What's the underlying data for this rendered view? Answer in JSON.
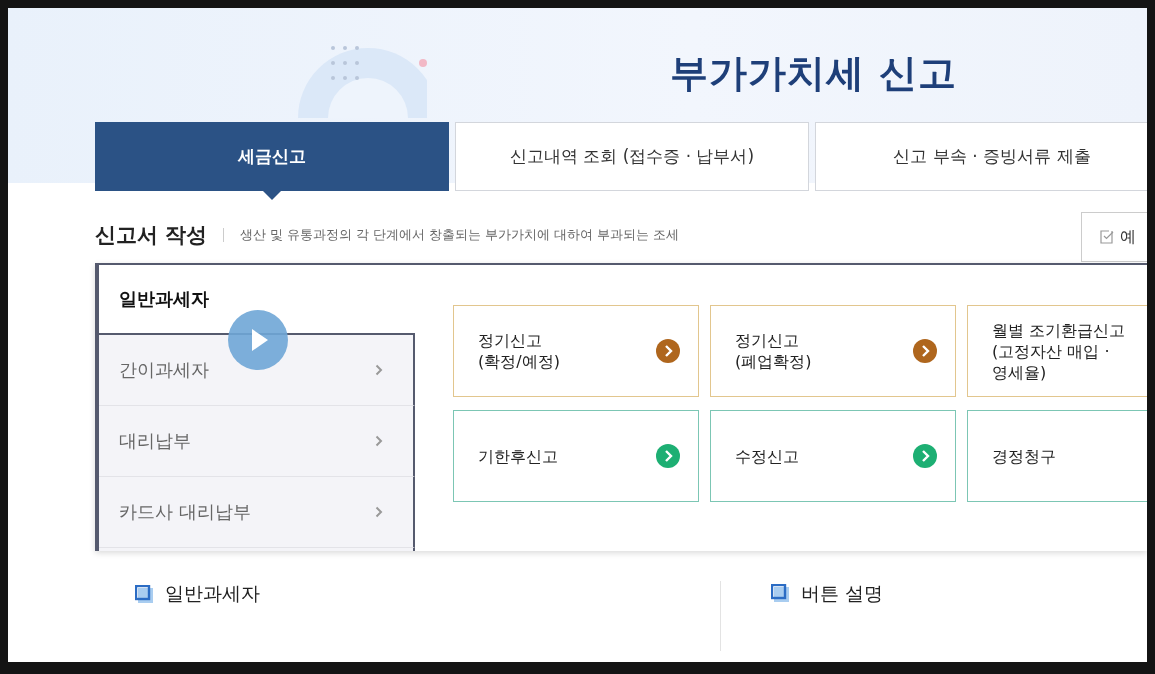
{
  "header": {
    "title": "부가가치세 신고"
  },
  "tabs": [
    {
      "label": "세금신고",
      "selected": true
    },
    {
      "label": "신고내역 조회 (접수증 · 납부서)",
      "selected": false
    },
    {
      "label": "신고 부속 · 증빙서류 제출",
      "selected": false
    }
  ],
  "section": {
    "title": "신고서 작성",
    "description": "생산 및 유통과정의 각 단계에서 창출되는 부가가치에 대하여 부과되는 조세",
    "button": "예"
  },
  "menu": [
    {
      "label": "일반과세자",
      "selected": true
    },
    {
      "label": "간이과세자",
      "selected": false
    },
    {
      "label": "대리납부",
      "selected": false
    },
    {
      "label": "카드사 대리납부",
      "selected": false
    }
  ],
  "cards": [
    {
      "lines": [
        "정기신고",
        "(확정/예정)"
      ],
      "color": "#e2c68e",
      "arrow": true
    },
    {
      "lines": [
        "정기신고",
        "(폐업확정)"
      ],
      "color": "#e2c68e",
      "arrow": true
    },
    {
      "lines": [
        "월별 조기환급신고",
        "(고정자산 매입 ·",
        "영세율)"
      ],
      "color": "#e2c68e",
      "arrow": false
    },
    {
      "lines": [
        "기한후신고"
      ],
      "color": "#7cc6b4",
      "arrow": true
    },
    {
      "lines": [
        "수정신고"
      ],
      "color": "#7cc6b4",
      "arrow": true
    },
    {
      "lines": [
        "경정청구"
      ],
      "color": "#7cc6b4",
      "arrow": false
    }
  ],
  "bottom": [
    {
      "title": "일반과세자"
    },
    {
      "title": "버튼 설명"
    }
  ]
}
